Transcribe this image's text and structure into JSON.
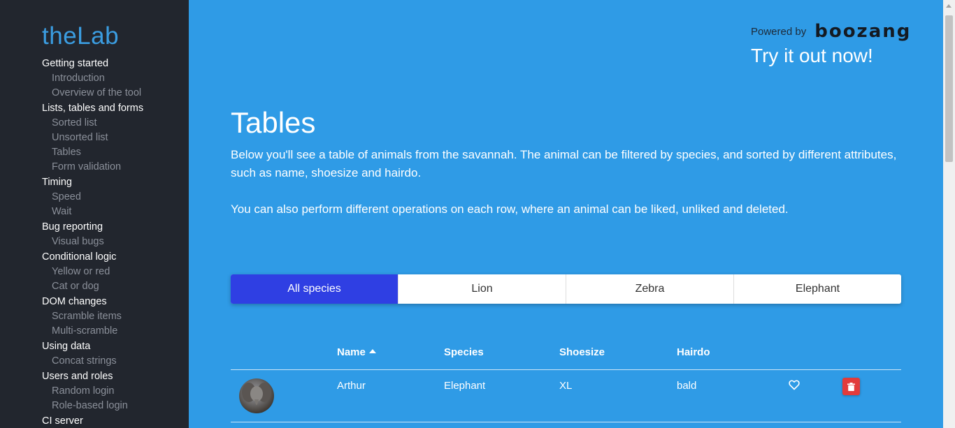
{
  "sidebar": {
    "brand": "theLab",
    "groups": [
      {
        "label": "Getting started",
        "items": [
          "Introduction",
          "Overview of the tool"
        ]
      },
      {
        "label": "Lists, tables and forms",
        "items": [
          "Sorted list",
          "Unsorted list",
          "Tables",
          "Form validation"
        ]
      },
      {
        "label": "Timing",
        "items": [
          "Speed",
          "Wait"
        ]
      },
      {
        "label": "Bug reporting",
        "items": [
          "Visual bugs"
        ]
      },
      {
        "label": "Conditional logic",
        "items": [
          "Yellow or red",
          "Cat or dog"
        ]
      },
      {
        "label": "DOM changes",
        "items": [
          "Scramble items",
          "Multi-scramble"
        ]
      },
      {
        "label": "Using data",
        "items": [
          "Concat strings"
        ]
      },
      {
        "label": "Users and roles",
        "items": [
          "Random login",
          "Role-based login"
        ]
      },
      {
        "label": "CI server",
        "items": []
      }
    ]
  },
  "header": {
    "powered_by": "Powered by",
    "logo": "boozang",
    "cta": "Try it out now!"
  },
  "page": {
    "title": "Tables",
    "description": "Below you'll see a table of animals from the savannah. The animal can be filtered by species, and sorted by different attributes, such as name, shoesize and hairdo.",
    "description2": "You can also perform different operations on each row, where an animal can be liked, unliked and deleted."
  },
  "filters": {
    "tabs": [
      "All species",
      "Lion",
      "Zebra",
      "Elephant"
    ],
    "active": "All species"
  },
  "table": {
    "headers": {
      "name": "Name",
      "species": "Species",
      "shoesize": "Shoesize",
      "hairdo": "Hairdo"
    },
    "sort": {
      "column": "Name",
      "direction": "ascending"
    },
    "rows": [
      {
        "name": "Arthur",
        "species": "Elephant",
        "shoesize": "XL",
        "hairdo": "bald"
      }
    ]
  },
  "colors": {
    "main_bg": "#2f9be6",
    "sidebar_bg": "#22262e",
    "brand": "#3b9de1",
    "active_tab": "#2f3fe3",
    "delete": "#e23b3b"
  },
  "icons": {
    "like": "heart-outline-icon",
    "delete": "trash-icon",
    "sort": "caret-up-icon"
  }
}
